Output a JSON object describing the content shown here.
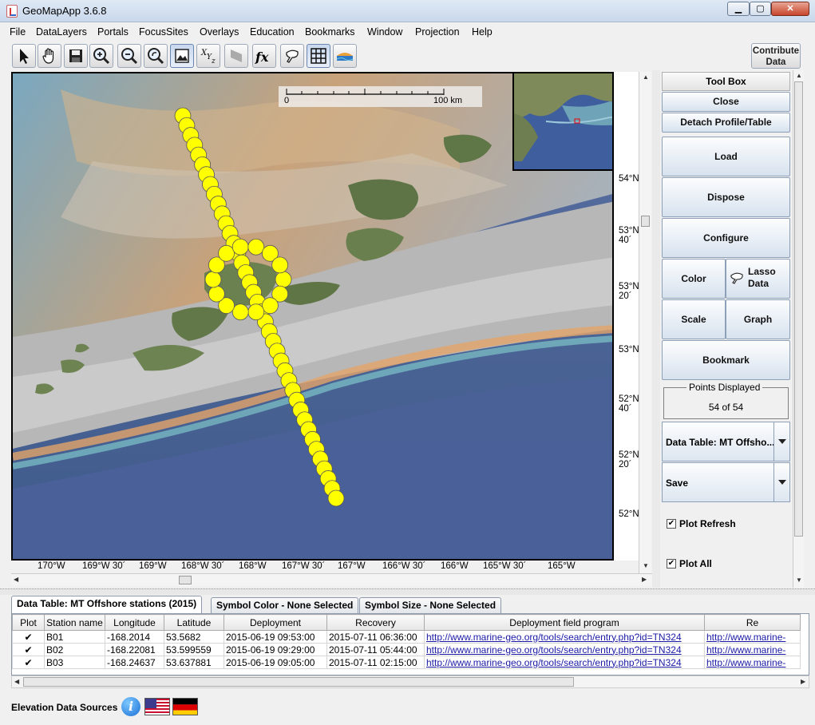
{
  "window": {
    "title": "GeoMapApp 3.6.8"
  },
  "menu": [
    "File",
    "DataLayers",
    "Portals",
    "FocusSites",
    "Overlays",
    "Education",
    "Bookmarks",
    "Window",
    "Projection",
    "Help"
  ],
  "toolbar": {
    "tools": [
      "select-arrow-icon",
      "pan-hand-icon",
      "save-disk-icon",
      "zoom-in-icon",
      "zoom-out-icon",
      "zoom-back-icon",
      "image-frame-icon",
      "xyz-icon",
      "flag-icon",
      "fx-icon",
      "lasso-icon",
      "grid-icon",
      "layers-icon"
    ],
    "contribute_line1": "Contribute",
    "contribute_line2": "Data"
  },
  "map": {
    "scale_start": "0",
    "scale_end": "100 km",
    "lat_labels": [
      "54°N",
      "53°N\n40´",
      "53°N\n20´",
      "53°N",
      "52°N\n40´",
      "52°N\n20´",
      "52°N"
    ],
    "lon_labels": [
      "170°W",
      "169°W 30´",
      "169°W",
      "168°W 30´",
      "168°W",
      "167°W 30´",
      "167°W",
      "166°W 30´",
      "166°W",
      "165°W 30´",
      "165°W"
    ],
    "point_color": "#ffff00"
  },
  "toolbox": {
    "title": "Tool Box",
    "close": "Close",
    "detach": "Detach Profile/Table",
    "load": "Load",
    "dispose": "Dispose",
    "configure": "Configure",
    "color": "Color",
    "lasso_line1": "Lasso",
    "lasso_line2": "Data",
    "scale": "Scale",
    "graph": "Graph",
    "bookmark": "Bookmark",
    "points_title": "Points Displayed",
    "points_value": "54 of 54",
    "data_table_combo": "Data Table: MT Offsho...",
    "save_combo": "Save",
    "plot_refresh": "Plot Refresh",
    "plot_all": "Plot All"
  },
  "tabs": [
    "Data Table: MT Offshore stations (2015)",
    "Symbol Color - None Selected",
    "Symbol Size - None Selected"
  ],
  "table": {
    "columns": [
      "Plot",
      "Station name",
      "Longitude",
      "Latitude",
      "Deployment",
      "Recovery",
      "Deployment field program",
      "Re"
    ],
    "rows": [
      [
        "✔",
        "B01",
        "-168.2014",
        "53.5682",
        "2015-06-19 09:53:00",
        "2015-07-11 06:36:00",
        "http://www.marine-geo.org/tools/search/entry.php?id=TN324",
        "http://www.marine-"
      ],
      [
        "✔",
        "B02",
        "-168.22081",
        "53.599559",
        "2015-06-19 09:29:00",
        "2015-07-11 05:44:00",
        "http://www.marine-geo.org/tools/search/entry.php?id=TN324",
        "http://www.marine-"
      ],
      [
        "✔",
        "B03",
        "-168.24637",
        "53.637881",
        "2015-06-19 09:05:00",
        "2015-07-11 02:15:00",
        "http://www.marine-geo.org/tools/search/entry.php?id=TN324",
        "http://www.marine-"
      ]
    ]
  },
  "footer": {
    "elevation_label": "Elevation Data Sources"
  }
}
